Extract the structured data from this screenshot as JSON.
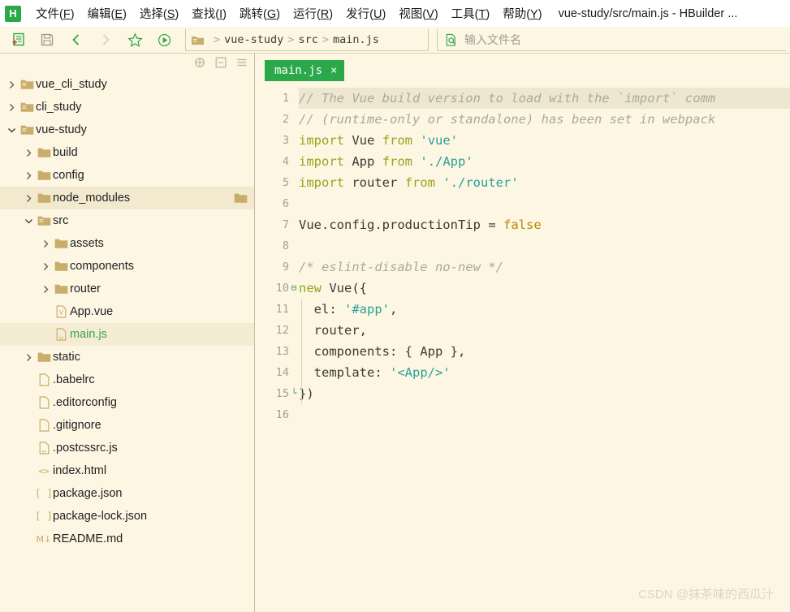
{
  "menubar": {
    "logo": "H",
    "logo_color": "#2aa84a",
    "items": [
      {
        "label": "文件",
        "key": "F"
      },
      {
        "label": "编辑",
        "key": "E"
      },
      {
        "label": "选择",
        "key": "S"
      },
      {
        "label": "查找",
        "key": "I"
      },
      {
        "label": "跳转",
        "key": "G"
      },
      {
        "label": "运行",
        "key": "R"
      },
      {
        "label": "发行",
        "key": "U"
      },
      {
        "label": "视图",
        "key": "V"
      },
      {
        "label": "工具",
        "key": "T"
      },
      {
        "label": "帮助",
        "key": "Y"
      }
    ],
    "window_title": "vue-study/src/main.js - HBuilder ..."
  },
  "toolbar": {
    "buttons": [
      {
        "name": "new-file-icon",
        "title": "新建"
      },
      {
        "name": "save-icon",
        "title": "保存"
      },
      {
        "name": "back-icon",
        "title": "后退"
      },
      {
        "name": "forward-icon",
        "title": "前进"
      },
      {
        "name": "star-icon",
        "title": "收藏"
      },
      {
        "name": "run-icon",
        "title": "运行"
      }
    ],
    "breadcrumb": [
      "vue-study",
      "src",
      "main.js"
    ],
    "breadcrumb_separator": ">",
    "search_placeholder": "输入文件名"
  },
  "sidebar": {
    "header_icons": [
      "target-icon",
      "collapse-panel-icon",
      "menu-icon"
    ],
    "tree": [
      {
        "label": "vue_cli_study",
        "depth": 0,
        "icon": "folder-open-icon",
        "twisty": "collapsed",
        "state": "normal"
      },
      {
        "label": "cli_study",
        "depth": 0,
        "icon": "folder-open-icon",
        "twisty": "collapsed",
        "state": "normal"
      },
      {
        "label": "vue-study",
        "depth": 0,
        "icon": "folder-open-icon",
        "twisty": "expanded",
        "state": "normal"
      },
      {
        "label": "build",
        "depth": 1,
        "icon": "folder-icon",
        "twisty": "collapsed",
        "state": "normal"
      },
      {
        "label": "config",
        "depth": 1,
        "icon": "folder-icon",
        "twisty": "collapsed",
        "state": "normal"
      },
      {
        "label": "node_modules",
        "depth": 1,
        "icon": "folder-icon",
        "twisty": "collapsed",
        "state": "hover",
        "trailing_icon": "folder-icon"
      },
      {
        "label": "src",
        "depth": 1,
        "icon": "folder-open-icon",
        "twisty": "expanded",
        "state": "normal"
      },
      {
        "label": "assets",
        "depth": 2,
        "icon": "folder-icon",
        "twisty": "collapsed",
        "state": "normal"
      },
      {
        "label": "components",
        "depth": 2,
        "icon": "folder-icon",
        "twisty": "collapsed",
        "state": "normal"
      },
      {
        "label": "router",
        "depth": 2,
        "icon": "folder-icon",
        "twisty": "collapsed",
        "state": "normal"
      },
      {
        "label": "App.vue",
        "depth": 2,
        "icon": "vue-file-icon",
        "twisty": "none",
        "state": "normal"
      },
      {
        "label": "main.js",
        "depth": 2,
        "icon": "js-file-icon",
        "twisty": "none",
        "state": "selected"
      },
      {
        "label": "static",
        "depth": 1,
        "icon": "folder-icon",
        "twisty": "collapsed",
        "state": "normal"
      },
      {
        "label": ".babelrc",
        "depth": 1,
        "icon": "file-icon",
        "twisty": "none",
        "state": "normal"
      },
      {
        "label": ".editorconfig",
        "depth": 1,
        "icon": "file-icon",
        "twisty": "none",
        "state": "normal"
      },
      {
        "label": ".gitignore",
        "depth": 1,
        "icon": "file-icon",
        "twisty": "none",
        "state": "normal"
      },
      {
        "label": ".postcssrc.js",
        "depth": 1,
        "icon": "js-file-icon",
        "twisty": "none",
        "state": "normal"
      },
      {
        "label": "index.html",
        "depth": 1,
        "icon": "html-file-icon",
        "twisty": "none",
        "state": "normal"
      },
      {
        "label": "package.json",
        "depth": 1,
        "icon": "json-file-icon",
        "twisty": "none",
        "state": "normal"
      },
      {
        "label": "package-lock.json",
        "depth": 1,
        "icon": "json-file-icon",
        "twisty": "none",
        "state": "normal"
      },
      {
        "label": "README.md",
        "depth": 1,
        "icon": "md-file-icon",
        "twisty": "none",
        "state": "normal"
      }
    ]
  },
  "editor": {
    "tab": {
      "label": "main.js",
      "close": "×",
      "active": true,
      "color": "#2aa84a"
    },
    "lines": [
      {
        "n": 1,
        "fold": "",
        "selected": true,
        "tokens": [
          {
            "t": "// The Vue build version to load with the `import` comm",
            "c": "cmt"
          }
        ]
      },
      {
        "n": 2,
        "fold": "",
        "selected": false,
        "tokens": [
          {
            "t": "// (runtime-only or standalone) has been set in webpack",
            "c": "cmt"
          }
        ]
      },
      {
        "n": 3,
        "fold": "",
        "selected": false,
        "tokens": [
          {
            "t": "import",
            "c": "kw"
          },
          {
            "t": " ",
            "c": "op"
          },
          {
            "t": "Vue",
            "c": "id"
          },
          {
            "t": " ",
            "c": "op"
          },
          {
            "t": "from",
            "c": "kw"
          },
          {
            "t": " ",
            "c": "op"
          },
          {
            "t": "'vue'",
            "c": "str"
          }
        ]
      },
      {
        "n": 4,
        "fold": "",
        "selected": false,
        "tokens": [
          {
            "t": "import",
            "c": "kw"
          },
          {
            "t": " ",
            "c": "op"
          },
          {
            "t": "App",
            "c": "id"
          },
          {
            "t": " ",
            "c": "op"
          },
          {
            "t": "from",
            "c": "kw"
          },
          {
            "t": " ",
            "c": "op"
          },
          {
            "t": "'./App'",
            "c": "str"
          }
        ]
      },
      {
        "n": 5,
        "fold": "",
        "selected": false,
        "tokens": [
          {
            "t": "import",
            "c": "kw"
          },
          {
            "t": " ",
            "c": "op"
          },
          {
            "t": "router",
            "c": "id"
          },
          {
            "t": " ",
            "c": "op"
          },
          {
            "t": "from",
            "c": "kw"
          },
          {
            "t": " ",
            "c": "op"
          },
          {
            "t": "'./router'",
            "c": "str"
          }
        ]
      },
      {
        "n": 6,
        "fold": "",
        "selected": false,
        "tokens": []
      },
      {
        "n": 7,
        "fold": "",
        "selected": false,
        "tokens": [
          {
            "t": "Vue.config.productionTip",
            "c": "id"
          },
          {
            "t": " ",
            "c": "op"
          },
          {
            "t": "=",
            "c": "op"
          },
          {
            "t": " ",
            "c": "op"
          },
          {
            "t": "false",
            "c": "bool"
          }
        ]
      },
      {
        "n": 8,
        "fold": "",
        "selected": false,
        "tokens": []
      },
      {
        "n": 9,
        "fold": "",
        "selected": false,
        "tokens": [
          {
            "t": "/* eslint-disable no-new */",
            "c": "cmt"
          }
        ]
      },
      {
        "n": 10,
        "fold": "⊟",
        "selected": false,
        "tokens": [
          {
            "t": "new",
            "c": "kw"
          },
          {
            "t": " ",
            "c": "op"
          },
          {
            "t": "Vue",
            "c": "id"
          },
          {
            "t": "({",
            "c": "op"
          }
        ]
      },
      {
        "n": 11,
        "fold": "",
        "selected": false,
        "tokens": [
          {
            "t": "  el",
            "c": "id"
          },
          {
            "t": ": ",
            "c": "op"
          },
          {
            "t": "'#app'",
            "c": "str"
          },
          {
            "t": ",",
            "c": "op"
          }
        ]
      },
      {
        "n": 12,
        "fold": "",
        "selected": false,
        "tokens": [
          {
            "t": "  router",
            "c": "id"
          },
          {
            "t": ",",
            "c": "op"
          }
        ]
      },
      {
        "n": 13,
        "fold": "",
        "selected": false,
        "tokens": [
          {
            "t": "  components",
            "c": "id"
          },
          {
            "t": ": { ",
            "c": "op"
          },
          {
            "t": "App",
            "c": "id"
          },
          {
            "t": " },",
            "c": "op"
          }
        ]
      },
      {
        "n": 14,
        "fold": "",
        "selected": false,
        "tokens": [
          {
            "t": "  template",
            "c": "id"
          },
          {
            "t": ": ",
            "c": "op"
          },
          {
            "t": "'<App/>'",
            "c": "str"
          }
        ]
      },
      {
        "n": 15,
        "fold": "└",
        "selected": false,
        "tokens": [
          {
            "t": "})",
            "c": "op"
          }
        ]
      },
      {
        "n": 16,
        "fold": "",
        "selected": false,
        "tokens": []
      }
    ]
  },
  "watermark": "CSDN @抹茶味的西瓜汁",
  "colors": {
    "background": "#fdf6e3",
    "accent_green": "#2aa84a",
    "folder": "#c9ad6a",
    "keyword": "#9aa31e",
    "string": "#2aa198",
    "comment": "#a6ab9c",
    "number": "#b58900"
  }
}
